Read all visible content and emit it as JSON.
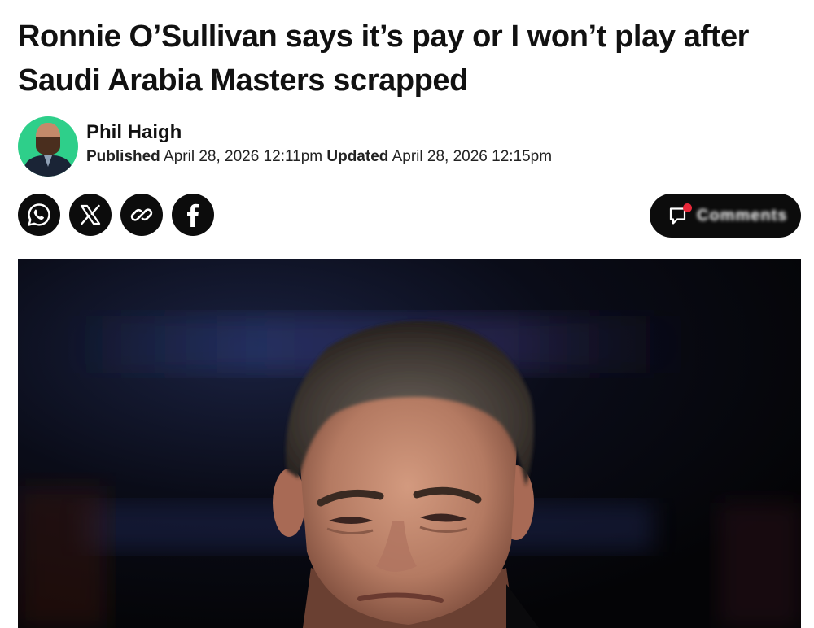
{
  "article": {
    "headline": "Ronnie O’Sullivan says it’s pay or I won’t play after Saudi Arabia Masters scrapped",
    "author": {
      "name": "Phil Haigh",
      "avatar_icon": "author-avatar"
    },
    "meta": {
      "published_label": "Published",
      "published_date": "April 28, 2026 12:11pm",
      "updated_label": "Updated",
      "updated_date": "April 28, 2026 12:15pm"
    }
  },
  "share": {
    "buttons": [
      {
        "icon": "whatsapp-icon"
      },
      {
        "icon": "x-icon"
      },
      {
        "icon": "link-icon"
      },
      {
        "icon": "facebook-icon"
      }
    ]
  },
  "comments": {
    "label": "Comments",
    "icon": "comment-icon",
    "badge_color": "#e8283a"
  },
  "hero_image": {
    "subject": "photo"
  },
  "colors": {
    "text": "#111111",
    "button_bg": "#0c0c0c",
    "avatar_bg": "#2ecf8a"
  }
}
